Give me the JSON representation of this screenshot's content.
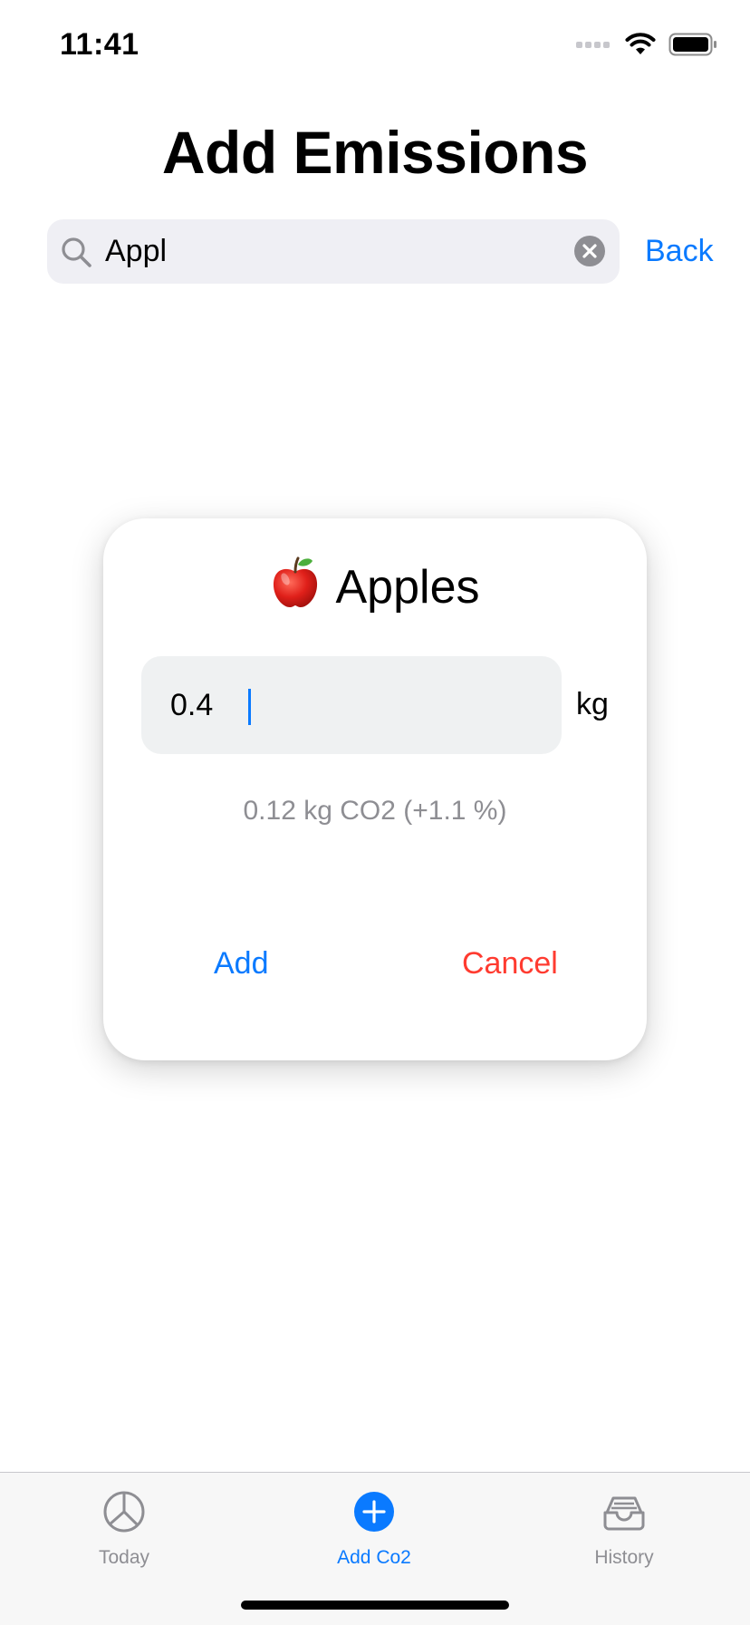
{
  "status_bar": {
    "time": "11:41",
    "icons": [
      "cellular-signal-icon",
      "wifi-icon",
      "battery-icon"
    ]
  },
  "header": {
    "title": "Add Emissions"
  },
  "search": {
    "value": "Appl",
    "placeholder": "",
    "icon": "search-icon",
    "clear_icon": "clear-icon",
    "back_label": "Back"
  },
  "dialog": {
    "emoji_icon": "apple-icon",
    "item_name": "Apples",
    "amount_value": "0.4",
    "unit": "kg",
    "emission_summary": "0.12 kg CO2 (+1.1 %)",
    "add_label": "Add",
    "cancel_label": "Cancel"
  },
  "tab_bar": {
    "tabs": [
      {
        "label": "Today",
        "icon": "pie-chart-icon",
        "active": false
      },
      {
        "label": "Add Co2",
        "icon": "plus-circle-icon",
        "active": true
      },
      {
        "label": "History",
        "icon": "tray-icon",
        "active": false
      }
    ]
  },
  "colors": {
    "accent": "#0a7aff",
    "destructive": "#ff3b30",
    "secondary_text": "#8e8e93",
    "search_background": "#efeff4",
    "field_background": "#eff1f2",
    "tab_bar_background": "#f7f7f7"
  }
}
